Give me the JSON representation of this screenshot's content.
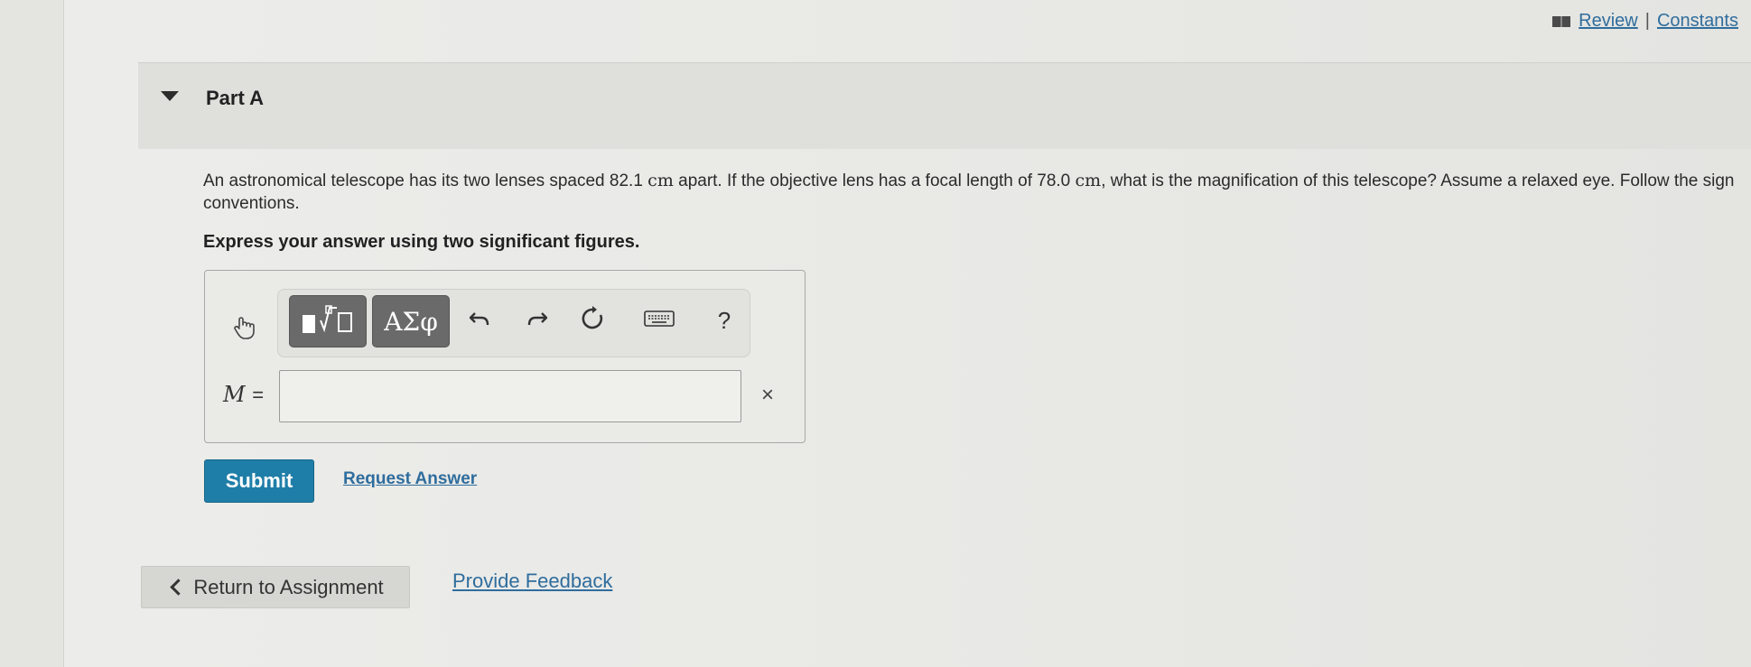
{
  "header": {
    "review_label": "Review",
    "separator": "|",
    "constants_label": "Constants",
    "book_icon": "book-icon"
  },
  "part": {
    "title": "Part A",
    "toggle_icon": "caret-down-icon"
  },
  "question": {
    "text_1": "An astronomical telescope has its two lenses spaced 82.1",
    "unit_1": "cm",
    "text_2": "apart. If the objective lens has a focal length of 78.0",
    "unit_2": "cm",
    "text_3": ", what is the magnification of this telescope? Assume a relaxed eye. Follow the sign conventions.",
    "instruction": "Express your answer using two significant figures."
  },
  "toolbar": {
    "greek_label": "ΑΣφ",
    "help_label": "?",
    "icons": [
      "templates-icon",
      "undo-icon",
      "redo-icon",
      "reset-icon",
      "keyboard-icon",
      "help-icon"
    ]
  },
  "answer": {
    "variable_label": "M",
    "equals": "=",
    "value": "",
    "clear_label": "×"
  },
  "actions": {
    "submit_label": "Submit",
    "request_answer_label": "Request Answer"
  },
  "footer": {
    "return_label": "Return to Assignment",
    "feedback_label": "Provide Feedback"
  },
  "colors": {
    "link": "#2f6d9d",
    "submit_bg": "#1f7ea8",
    "toolbar_dark": "#6a6a6a"
  }
}
